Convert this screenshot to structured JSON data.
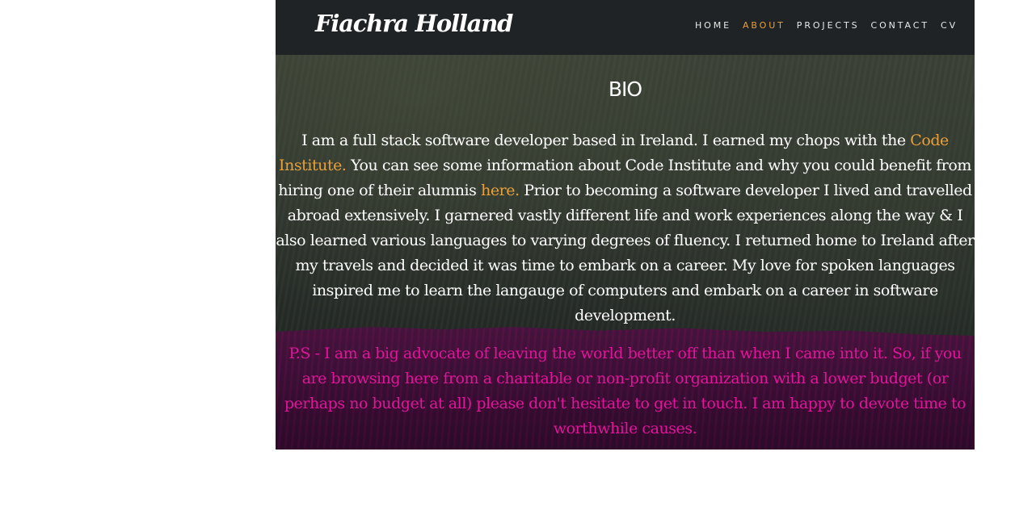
{
  "header": {
    "brand": "Fiachra Holland",
    "nav": [
      {
        "label": "HOME",
        "active": false
      },
      {
        "label": "ABOUT",
        "active": true
      },
      {
        "label": "PROJECTS",
        "active": false
      },
      {
        "label": "CONTACT",
        "active": false
      },
      {
        "label": "CV",
        "active": false
      }
    ]
  },
  "bio": {
    "title": "BIO",
    "lines": [
      "I am a full stack software developer based in Ireland. I earned my chops with the ",
      "Code Institute.",
      " You can see some information about Code Institute and why you could benefit from hiring one of their alumnis ",
      "here.",
      " Prior to becoming a software developer I lived and travelled abroad extensively. I garnered vastly different life and work experiences along the way & I also learned various languages to varying degrees of fluency. I returned home to Ireland after my travels and decided it was time to embark on a career. My love for spoken languages inspired me to learn the langauge of computers and embark on a career in software development."
    ],
    "ps": "P.S - I am a big advocate of leaving the world better off than when I came into it. So, if you are browsing here from a charitable or non-profit organization with a lower budget (or perhaps no budget at all) please don't hesitate to get in touch. I am happy to devote time to worthwhile causes."
  },
  "colors": {
    "navbar": "#1f2326",
    "accent": "#e8a03a",
    "ps_text": "#e0159a"
  }
}
